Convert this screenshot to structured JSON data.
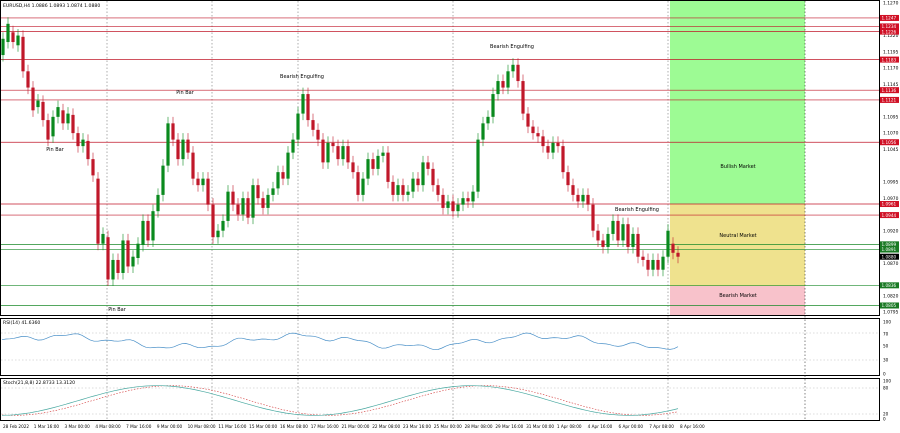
{
  "header": {
    "symbol_line": "EURUSD,H4  1.0886 1.0893 1.0874 1.0880"
  },
  "colors": {
    "bull": "#0a8a1e",
    "bear": "#c0182a",
    "res_line": "#c0182a",
    "sup_line": "#1b8a2a",
    "bullish_zone": "#9dfb94",
    "neutral_zone": "#efe28e",
    "bearish_zone": "#f8c2cb",
    "rsi_line": "#4a90c8",
    "stoch_main": "#48a8a0",
    "stoch_signal": "#d23a3a"
  },
  "price_axis": {
    "labels": [
      "1.1270",
      "1.1220",
      "1.1195",
      "1.1170",
      "1.1145",
      "1.1095",
      "1.1070",
      "1.1045",
      "1.0995",
      "1.0970",
      "1.0920",
      "1.0870",
      "1.0820",
      "1.0795"
    ],
    "level_tags": [
      {
        "value": "1.1247",
        "kind": "res"
      },
      {
        "value": "1.1234",
        "kind": "res"
      },
      {
        "value": "1.1226",
        "kind": "res"
      },
      {
        "value": "1.1183",
        "kind": "res"
      },
      {
        "value": "1.1136",
        "kind": "res"
      },
      {
        "value": "1.1121",
        "kind": "res"
      },
      {
        "value": "1.1056",
        "kind": "res"
      },
      {
        "value": "1.0961",
        "kind": "res"
      },
      {
        "value": "1.0944",
        "kind": "res"
      },
      {
        "value": "1.0899",
        "kind": "sup"
      },
      {
        "value": "1.0891",
        "kind": "sup"
      },
      {
        "value": "1.0880",
        "kind": "cur"
      },
      {
        "value": "1.0836",
        "kind": "sup"
      },
      {
        "value": "1.0805",
        "kind": "sup"
      }
    ]
  },
  "zones": {
    "bullish_label": "Bullish Market",
    "neutral_label": "Neutral Market",
    "bearish_label": "Bearish Market"
  },
  "annotations": [
    "Pin Bar",
    "Pin Bar",
    "Bearish Engulfing",
    "Bearish Engulfing",
    "Pin Bar",
    "Bearish Engulfing"
  ],
  "rsi": {
    "title": "RSI(14) 41.6360",
    "levels": [
      "100",
      "70",
      "50",
      "30",
      "0"
    ]
  },
  "stoch": {
    "title": "Stoch(21,8,8) 22.8733 13.3120",
    "levels": [
      "100",
      "80",
      "20",
      "0"
    ]
  },
  "time_axis": [
    "28 Feb 2022",
    "1 Mar 16:00",
    "3 Mar 00:00",
    "4 Mar 08:00",
    "7 Mar 16:00",
    "9 Mar 00:00",
    "10 Mar 08:00",
    "11 Mar 16:00",
    "15 Mar 00:00",
    "16 Mar 08:00",
    "17 Mar 16:00",
    "21 Mar 00:00",
    "22 Mar 08:00",
    "23 Mar 16:00",
    "25 Mar 00:00",
    "28 Mar 08:00",
    "29 Mar 16:00",
    "31 Mar 00:00",
    "1 Apr 08:00",
    "4 Apr 16:00",
    "6 Apr 00:00",
    "7 Apr 08:00",
    "8 Apr 16:00"
  ]
}
